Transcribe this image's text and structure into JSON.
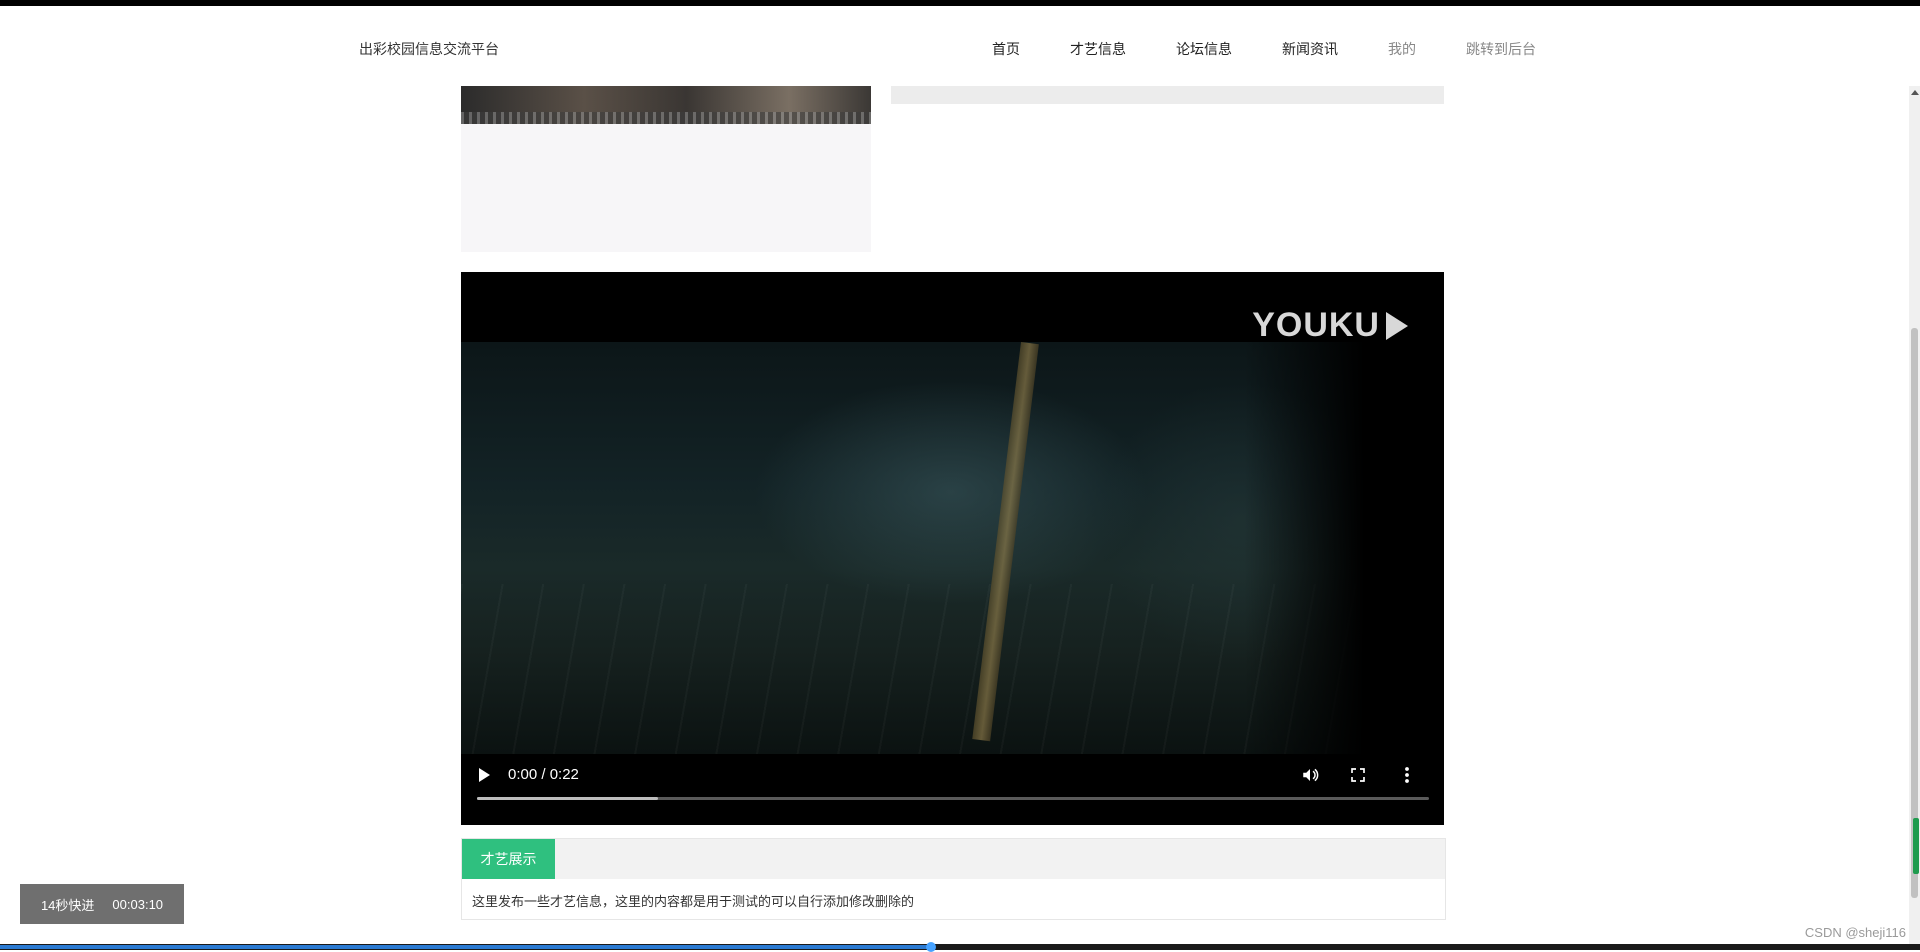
{
  "site": {
    "brand": "出彩校园信息交流平台"
  },
  "nav": {
    "items": [
      {
        "label": "首页",
        "muted": false
      },
      {
        "label": "才艺信息",
        "muted": false
      },
      {
        "label": "论坛信息",
        "muted": false
      },
      {
        "label": "新闻资讯",
        "muted": false
      },
      {
        "label": "我的",
        "muted": true
      },
      {
        "label": "跳转到后台",
        "muted": true
      }
    ]
  },
  "video": {
    "logo": "YOUKU",
    "time": "0:00 / 0:22",
    "progress_fraction": 0.19,
    "icons": [
      "play-icon",
      "volume-icon",
      "fullscreen-icon",
      "more-icon"
    ]
  },
  "talent": {
    "tab_label": "才艺展示",
    "description": "这里发布一些才艺信息，这里的内容都是用于测试的可以自行添加修改删除的"
  },
  "overlay": {
    "label": "14秒快进",
    "time": "00:03:10"
  },
  "watermark": "CSDN @sheji116",
  "playback_bar": {
    "progress_fraction": 0.485
  }
}
